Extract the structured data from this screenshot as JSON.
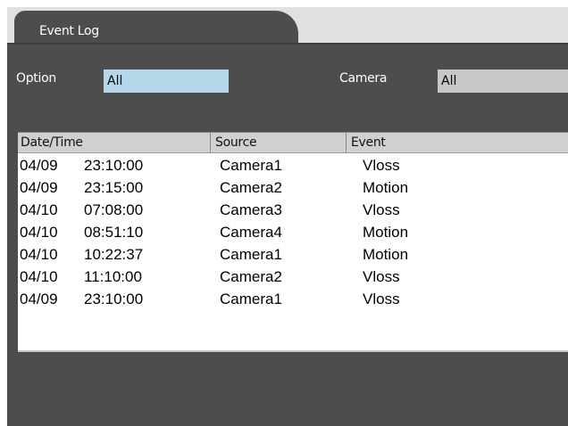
{
  "window": {
    "tab_title": "Event Log"
  },
  "filters": {
    "option_label": "Option",
    "option_value": "All",
    "camera_label": "Camera",
    "camera_value": "All"
  },
  "table": {
    "columns": [
      "Date/Time",
      "Source",
      "Event"
    ],
    "rows": [
      {
        "date": "04/09",
        "time": "23:10:00",
        "source": "Camera1",
        "event": "Vloss"
      },
      {
        "date": "04/09",
        "time": "23:15:00",
        "source": "Camera2",
        "event": "Motion"
      },
      {
        "date": "04/10",
        "time": "07:08:00",
        "source": "Camera3",
        "event": "Vloss"
      },
      {
        "date": "04/10",
        "time": "08:51:10",
        "source": "Camera4",
        "event": "Motion"
      },
      {
        "date": "04/10",
        "time": "10:22:37",
        "source": "Camera1",
        "event": "Motion"
      },
      {
        "date": "04/10",
        "time": "11:10:00",
        "source": "Camera2",
        "event": "Vloss"
      },
      {
        "date": "04/09",
        "time": "23:10:00",
        "source": "Camera1",
        "event": "Vloss"
      }
    ]
  }
}
